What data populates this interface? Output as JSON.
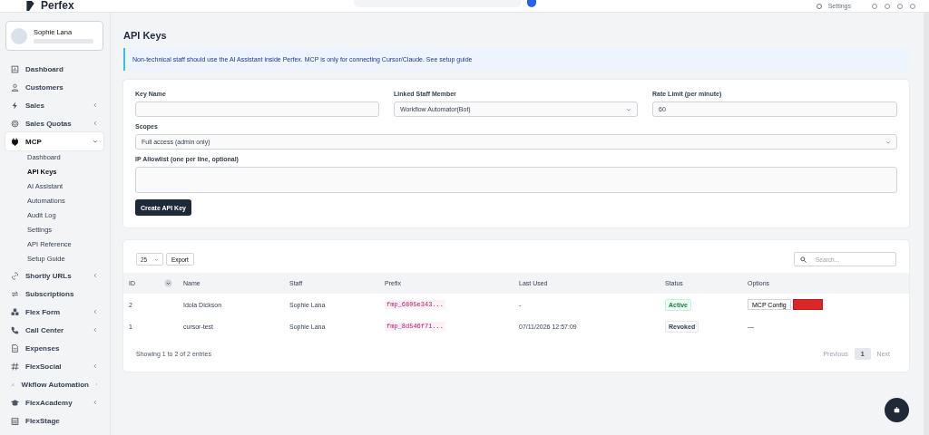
{
  "header": {
    "logo": "Perfex",
    "settings": "Settings"
  },
  "sidebar": {
    "user": {
      "name": "Sophie Lana"
    },
    "items": [
      {
        "label": "Dashboard",
        "submenu": false,
        "selected": false
      },
      {
        "label": "Customers",
        "submenu": false,
        "selected": false
      },
      {
        "label": "Sales",
        "submenu": true,
        "selected": false
      },
      {
        "label": "Sales Quotas",
        "submenu": true,
        "selected": false
      },
      {
        "label": "MCP",
        "submenu": true,
        "selected": true,
        "expanded": true,
        "children": [
          {
            "label": "Dashboard",
            "selected": false
          },
          {
            "label": "API Keys",
            "selected": true
          },
          {
            "label": "AI Assistant",
            "selected": false
          },
          {
            "label": "Automations",
            "selected": false
          },
          {
            "label": "Audit Log",
            "selected": false
          },
          {
            "label": "Settings",
            "selected": false
          },
          {
            "label": "API Reference",
            "selected": false
          },
          {
            "label": "Setup Guide",
            "selected": false
          }
        ]
      },
      {
        "label": "Shortly URLs",
        "submenu": true,
        "selected": false
      },
      {
        "label": "Subscriptions",
        "submenu": false,
        "selected": false
      },
      {
        "label": "Flex Form",
        "submenu": true,
        "selected": false
      },
      {
        "label": "Call Center",
        "submenu": true,
        "selected": false
      },
      {
        "label": "Expenses",
        "submenu": false,
        "selected": false
      },
      {
        "label": "FlexSocial",
        "submenu": true,
        "selected": false
      },
      {
        "label": "Wkflow Automation",
        "submenu": true,
        "selected": false
      },
      {
        "label": "FlexAcademy",
        "submenu": true,
        "selected": false
      },
      {
        "label": "FlexStage",
        "submenu": false,
        "selected": false
      }
    ]
  },
  "page": {
    "title": "API Keys",
    "alert": "Non-technical staff should use the AI Assistant inside Perfex. MCP is only for connecting Cursor/Claude. See setup guide"
  },
  "form": {
    "fields": [
      {
        "label": "Key Name",
        "kind": "text"
      },
      {
        "label": "Linked Staff Member",
        "kind": "select",
        "value": "Workflow Automator(Bot)"
      },
      {
        "label": "Rate Limit (per minute)",
        "kind": "text",
        "value": "60"
      },
      {
        "label": "Scopes",
        "kind": "select",
        "value": "Full access (admin only)"
      },
      {
        "label": "IP Allowlist (one per line, optional)",
        "kind": "textarea"
      }
    ],
    "button": "Create API Key"
  },
  "table": {
    "page_length": "25",
    "export": "Export",
    "search": {
      "placeholder": "Search..."
    },
    "columns": [
      "ID",
      "Name",
      "Staff",
      "Prefix",
      "Last Used",
      "Status",
      "Options"
    ],
    "rows": [
      {
        "id": "2",
        "name": "Idola Dickson",
        "staff": "Sophie Lana",
        "prefix": "fmp_6805e343...",
        "last_used": "-",
        "status": {
          "label": "Active",
          "kind": "active"
        },
        "options": [
          {
            "kind": "outline",
            "label": "MCP Config"
          },
          {
            "kind": "danger"
          }
        ]
      },
      {
        "id": "1",
        "name": "cursor-test",
        "staff": "Sophie Lana",
        "prefix": "fmp_8d546f71...",
        "last_used": "07/11/2026 12:57:09",
        "status": {
          "label": "Revoked",
          "kind": "revoked"
        },
        "options": [
          {
            "kind": "text",
            "label": "—"
          }
        ]
      }
    ],
    "info": "Showing 1 to 2 of 2 entries",
    "pagination": [
      {
        "label": "Previous",
        "disabled": true
      },
      {
        "label": "1",
        "selected": true
      },
      {
        "label": "Next",
        "disabled": true
      }
    ]
  }
}
